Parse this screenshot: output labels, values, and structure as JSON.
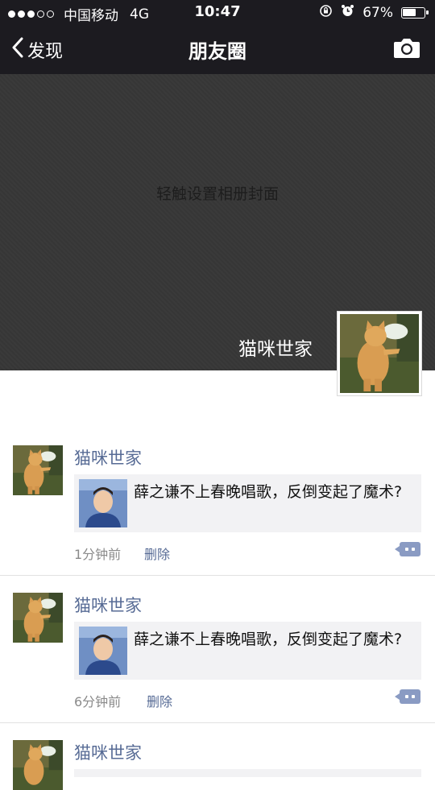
{
  "status_bar": {
    "carrier": "中国移动",
    "network": "4G",
    "time": "10:47",
    "battery": "67%",
    "battery_level": 0.67,
    "signal_filled": 3,
    "signal_total": 5
  },
  "nav": {
    "back_label": "发现",
    "title": "朋友圈"
  },
  "cover": {
    "hint": "轻触设置相册封面",
    "username": "猫咪世家"
  },
  "posts": [
    {
      "name": "猫咪世家",
      "link_text": "薛之谦不上春晚唱歌，反倒变起了魔术?",
      "time": "1分钟前",
      "delete_label": "删除"
    },
    {
      "name": "猫咪世家",
      "link_text": "薛之谦不上春晚唱歌，反倒变起了魔术?",
      "time": "6分钟前",
      "delete_label": "删除"
    },
    {
      "name": "猫咪世家"
    }
  ],
  "colors": {
    "nav_bg": "#1c1b20",
    "link_blue": "#576b95",
    "card_bg": "#f2f2f4",
    "comment_button": "#8a9bc3"
  },
  "icons": {
    "back": "chevron-left-icon",
    "camera": "camera-icon",
    "alarm": "alarm-icon",
    "rotation_lock": "rotation-lock-icon",
    "comment": "comment-bubble-icon"
  }
}
